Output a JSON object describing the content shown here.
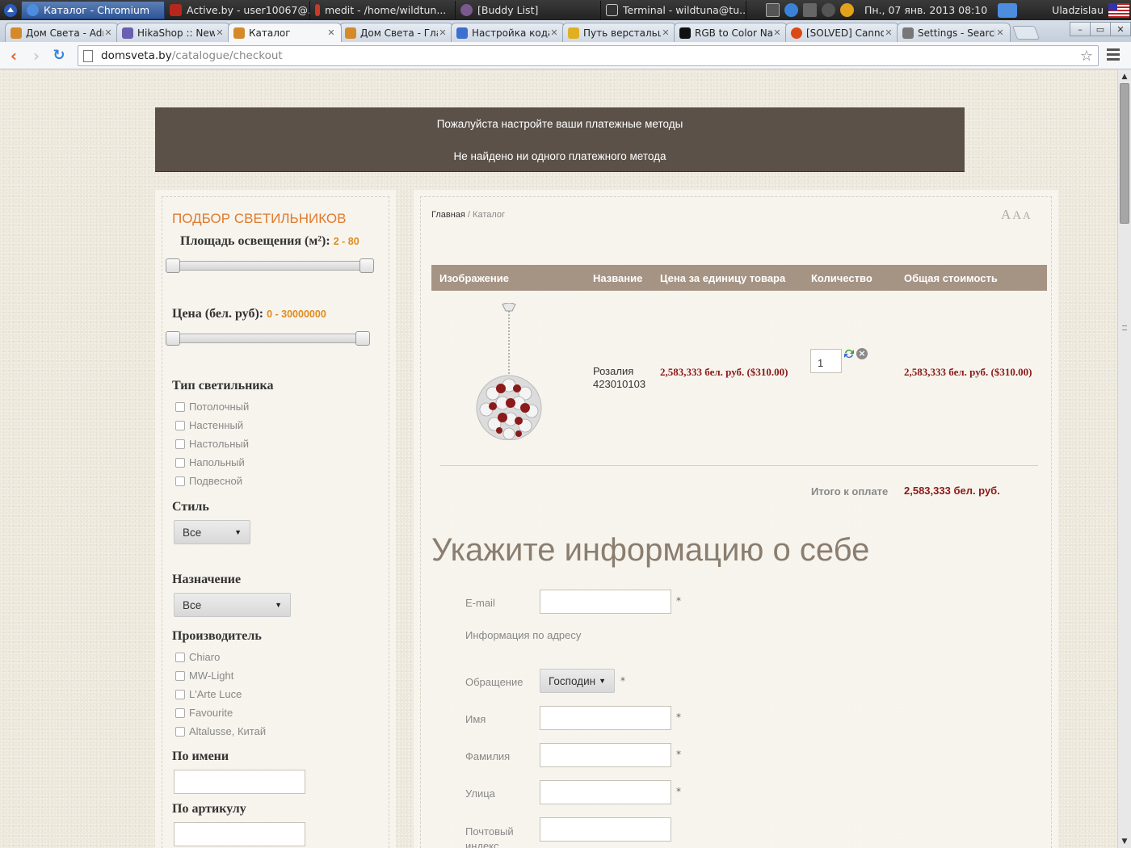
{
  "os_panel": {
    "tasks": [
      {
        "label": "Каталог - Chromium",
        "active": true
      },
      {
        "label": "Active.by - user10067@...",
        "active": false
      },
      {
        "label": "medit - /home/wildtun...",
        "active": false
      },
      {
        "label": "[Buddy List]",
        "active": false
      },
      {
        "label": "Terminal - wildtuna@tu...",
        "active": false
      }
    ],
    "clock": "Пн., 07 янв. 2013 08:10",
    "user": "Uladzislau"
  },
  "browser": {
    "tabs": [
      {
        "label": "Дом Света - Adm",
        "color": "#d58a2a"
      },
      {
        "label": "HikaShop :: New",
        "color": "#6a5fb0"
      },
      {
        "label": "Каталог",
        "color": "#d58a2a"
      },
      {
        "label": "Дом Света - Глав",
        "color": "#d58a2a"
      },
      {
        "label": "Настройка кода",
        "color": "#3b6fd0"
      },
      {
        "label": "Путь верстальщ",
        "color": "#e0b020"
      },
      {
        "label": "RGB to Color Nar",
        "color": "#111111"
      },
      {
        "label": "[SOLVED] Cannot",
        "color": "#dd4814"
      },
      {
        "label": "Settings - Search",
        "color": "#777777"
      }
    ],
    "active_tab": 2,
    "url": {
      "host": "domsveta.by",
      "path": "/catalogue/checkout"
    }
  },
  "notice": {
    "line1": "Пожалуйста настройте ваши платежные методы",
    "line2": "Не найдено ни одного платежного метода"
  },
  "sidebar": {
    "title": "ПОДБОР СВЕТИЛЬНИКОВ",
    "area_label": "Площадь освещения (м²)",
    "area_range": "2 - 80",
    "price_label": "Цена (бел. руб)",
    "price_range": "0 - 30000000",
    "type_label": "Тип светильника",
    "types": [
      "Потолочный",
      "Настенный",
      "Настольный",
      "Напольный",
      "Подвесной"
    ],
    "style_label": "Стиль",
    "style_value": "Все",
    "purpose_label": "Назначение",
    "purpose_value": "Все",
    "maker_label": "Производитель",
    "makers": [
      "Chiaro",
      "MW-Light",
      "L'Arte Luce",
      "Favourite",
      "Altalusse, Китай"
    ],
    "name_label": "По имени",
    "article_label": "По артикулу"
  },
  "main": {
    "breadcrumb": {
      "home": "Главная",
      "sep": " / ",
      "current": "Каталог"
    },
    "font_sizer": [
      "A",
      "A",
      "A"
    ],
    "columns": [
      "Изображение",
      "Название",
      "Цена за единицу товара",
      "Количество",
      "Общая стоимость"
    ],
    "item": {
      "name": "Розалия",
      "code": "423010103",
      "unit_price": "2,583,333 бел. руб. ($310.00)",
      "quantity": "1",
      "total": "2,583,333 бел. руб. ($310.00)"
    },
    "total_label": "Итого к оплате",
    "total_value": "2,583,333 бел. руб.",
    "section_title": "Укажите информацию о себе",
    "form": {
      "email": "E-mail",
      "address_info": "Информация по адресу",
      "salutation": "Обращение",
      "salutation_value": "Господин",
      "first_name": "Имя",
      "last_name": "Фамилия",
      "street": "Улица",
      "postal": "Почтовый индекс",
      "required_mark": "*"
    }
  },
  "colors": {
    "accent_orange": "#e07a2c",
    "price_red": "#8b1a1a",
    "notice_bg": "#5b5149",
    "table_head": "#a59384"
  }
}
